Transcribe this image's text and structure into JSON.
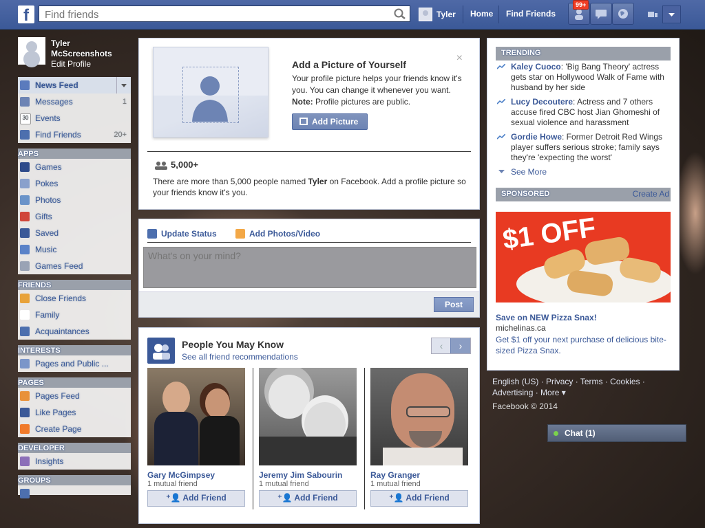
{
  "topbar": {
    "logo": "f",
    "search_placeholder": "Find friends",
    "user_name": "Tyler",
    "home": "Home",
    "find_friends": "Find Friends",
    "friend_requests_badge": "99+"
  },
  "profile": {
    "name": "Tyler McScreenshots",
    "edit": "Edit Profile"
  },
  "nav": {
    "favorites": [
      {
        "label": "News Feed",
        "count": ""
      },
      {
        "label": "Messages",
        "count": "1"
      },
      {
        "label": "Events",
        "count": ""
      },
      {
        "label": "Find Friends",
        "count": "20+"
      }
    ],
    "apps_title": "APPS",
    "apps": [
      "Games",
      "Pokes",
      "Photos",
      "Gifts",
      "Saved",
      "Music",
      "Games Feed"
    ],
    "friends_title": "FRIENDS",
    "friends": [
      "Close Friends",
      "Family",
      "Acquaintances"
    ],
    "interests_title": "INTERESTS",
    "interests": [
      "Pages and Public ..."
    ],
    "pages_title": "PAGES",
    "pages": [
      "Pages Feed",
      "Like Pages",
      "Create Page"
    ],
    "developer_title": "DEVELOPER",
    "developer": [
      "Insights"
    ],
    "groups_title": "GROUPS"
  },
  "picture_prompt": {
    "title": "Add a Picture of Yourself",
    "desc_1": "Your profile picture helps your friends know it's you. You can change it whenever you want. ",
    "desc_note": "Note:",
    "desc_2": " Profile pictures are public.",
    "button": "Add Picture",
    "count": "5,000+",
    "count_desc_1": "There are more than 5,000 people named ",
    "count_name": "Tyler",
    "count_desc_2": " on Facebook. Add a profile picture so your friends know it's you."
  },
  "composer": {
    "tab_status": "Update Status",
    "tab_photos": "Add Photos/Video",
    "placeholder": "What's on your mind?",
    "post": "Post"
  },
  "pymk": {
    "title": "People You May Know",
    "subtitle": "See all friend recommendations",
    "people": [
      {
        "name": "Gary McGimpsey",
        "mutual": "1 mutual friend",
        "action": "Add Friend"
      },
      {
        "name": "Jeremy Jim Sabourin",
        "mutual": "1 mutual friend",
        "action": "Add Friend"
      },
      {
        "name": "Ray Granger",
        "mutual": "1 mutual friend",
        "action": "Add Friend"
      }
    ]
  },
  "trending": {
    "title": "TRENDING",
    "items": [
      {
        "topic": "Kaley Cuoco",
        "text": ": 'Big Bang Theory' actress gets star on Hollywood Walk of Fame with husband by her side"
      },
      {
        "topic": "Lucy Decoutere",
        "text": ": Actress and 7 others accuse fired CBC host Jian Ghomeshi of sexual violence and harassment"
      },
      {
        "topic": "Gordie Howe",
        "text": ": Former Detroit Red Wings player suffers serious stroke; family says they're 'expecting the worst'"
      }
    ],
    "see_more": "See More"
  },
  "sponsored": {
    "title": "SPONSORED",
    "create_ad": "Create Ad",
    "ad_image_text": "$1 OFF",
    "ad_title": "Save on NEW Pizza Snax!",
    "ad_host": "michelinas.ca",
    "ad_desc": "Get $1 off your next purchase of delicious bite-sized Pizza Snax."
  },
  "footer": {
    "links": [
      "English (US)",
      "Privacy",
      "Terms",
      "Cookies",
      "Advertising",
      "More"
    ],
    "copyright": "Facebook © 2014"
  },
  "chat": {
    "label": "Chat (1)"
  }
}
